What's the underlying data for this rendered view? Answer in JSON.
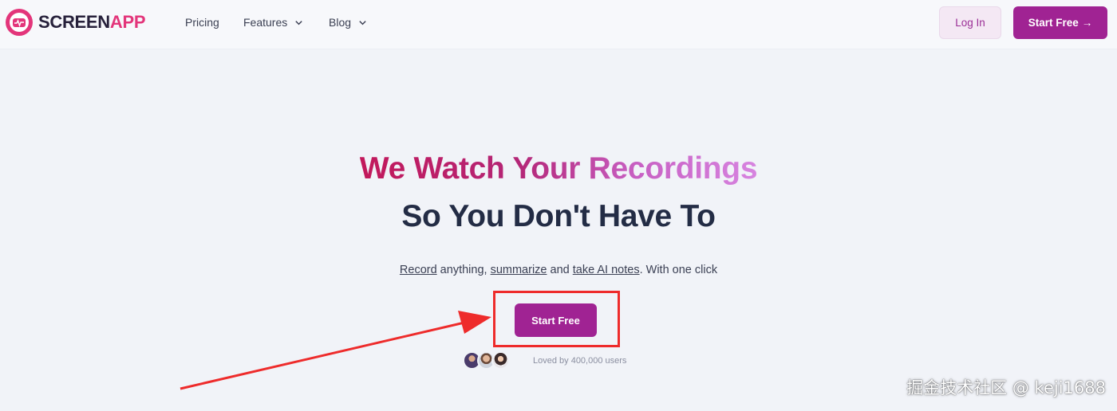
{
  "brand": {
    "name_part1": "SCREEN",
    "name_part2": "APP",
    "accent_color": "#a02393",
    "logo_color": "#e3357a"
  },
  "nav": {
    "links": [
      {
        "label": "Pricing",
        "has_dropdown": false
      },
      {
        "label": "Features",
        "has_dropdown": true
      },
      {
        "label": "Blog",
        "has_dropdown": true
      }
    ],
    "login_label": "Log In",
    "start_free_label": "Start Free",
    "start_free_arrow": "→"
  },
  "hero": {
    "title": "We Watch Your Recordings",
    "subtitle": "So You Don't Have To",
    "tagline": {
      "record": "Record",
      "t1": " anything, ",
      "summarize": "summarize",
      "t2": " and ",
      "ai_notes": "take AI notes",
      "t3": ". With one click"
    },
    "cta_label": "Start Free",
    "social_proof": "Loved by 400,000 users"
  },
  "annotation": {
    "highlight_color": "#ee2b2b"
  },
  "watermark": "掘金技术社区 @ keji1688"
}
